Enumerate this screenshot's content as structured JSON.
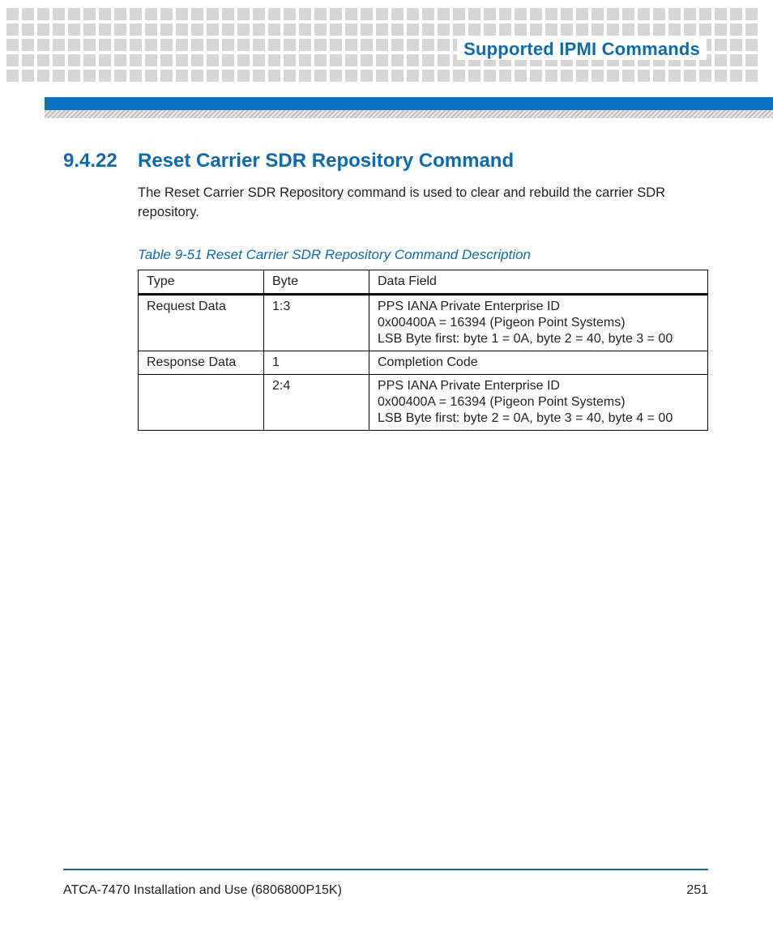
{
  "header": {
    "title": "Supported IPMI Commands"
  },
  "section": {
    "number": "9.4.22",
    "title": "Reset Carrier SDR Repository Command",
    "body": "The Reset Carrier SDR Repository command is used to clear and rebuild the carrier SDR repository."
  },
  "table": {
    "caption": "Table 9-51 Reset Carrier SDR Repository Command Description",
    "headers": [
      "Type",
      "Byte",
      "Data Field"
    ],
    "rows": [
      {
        "type": "Request Data",
        "byte": "1:3",
        "data_lines": [
          "PPS IANA Private Enterprise ID",
          "0x00400A = 16394 (Pigeon Point Systems)",
          "LSB Byte first: byte 1 = 0A, byte 2 = 40, byte 3 = 00"
        ]
      },
      {
        "type": "Response Data",
        "byte": "1",
        "data_lines": [
          "Completion Code"
        ]
      },
      {
        "type": "",
        "byte": "2:4",
        "data_lines": [
          "PPS IANA Private Enterprise ID",
          "0x00400A = 16394 (Pigeon Point Systems)",
          "LSB Byte first: byte 2 = 0A, byte 3 = 40, byte 4 = 00"
        ]
      }
    ]
  },
  "footer": {
    "doc": "ATCA-7470 Installation and Use (6806800P15K)",
    "page": "251"
  }
}
